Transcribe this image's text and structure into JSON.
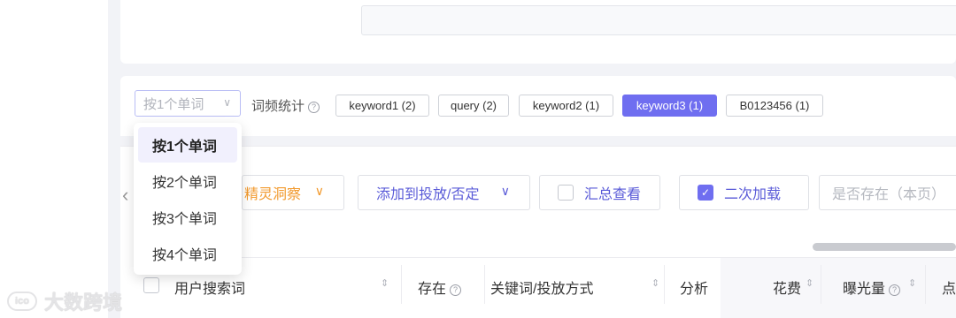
{
  "filter": {
    "select_value": "按1个单词",
    "freq_label": "词频统计",
    "help_icon": "?",
    "tags": [
      {
        "label": "keyword1 (2)",
        "active": false
      },
      {
        "label": "query (2)",
        "active": false
      },
      {
        "label": "keyword2 (1)",
        "active": false
      },
      {
        "label": "keyword3 (1)",
        "active": true
      },
      {
        "label": "B0123456 (1)",
        "active": false
      }
    ],
    "accent_color": "#6f6ef0"
  },
  "dropdown": {
    "options": [
      "按1个单词",
      "按2个单词",
      "按3个单词",
      "按4个单词"
    ],
    "selected_index": 0
  },
  "toolbar": {
    "insight_label": "精灵洞察",
    "add_label": "添加到投放/否定",
    "summary_label": "汇总查看",
    "secondary_load_label": "二次加载",
    "secondary_load_checked": true,
    "exists_placeholder": "是否存在（本页）"
  },
  "table": {
    "headers": {
      "search_term": "用户搜索词",
      "exists": "存在",
      "keyword_mode": "关键词/投放方式",
      "analysis": "分析",
      "cost": "花费",
      "impressions": "曝光量",
      "clicks": "点"
    }
  },
  "watermark": {
    "text": "大数跨境",
    "icon": "ico-logo"
  },
  "icons": {
    "chevron_down": "∨",
    "chevron_left": "‹",
    "sort": "⇕",
    "check": "✓"
  }
}
